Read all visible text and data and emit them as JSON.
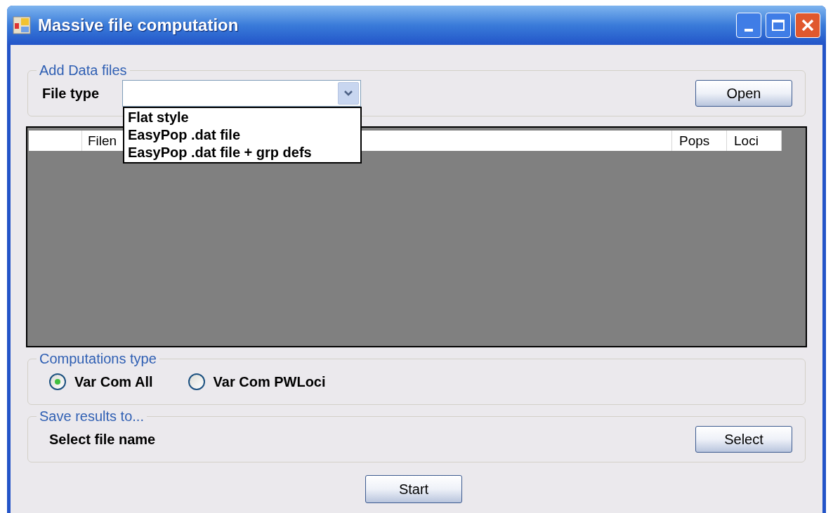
{
  "window": {
    "title": "Massive file computation"
  },
  "add_data_files": {
    "legend": "Add Data files",
    "file_type_label": "File type",
    "expanded": true,
    "options": [
      {
        "label": "Flat style"
      },
      {
        "label": "EasyPop .dat file"
      },
      {
        "label": "EasyPop .dat file + grp defs"
      }
    ],
    "open_button": "Open"
  },
  "table": {
    "columns": [
      "Filen",
      "Pops",
      "Loci"
    ]
  },
  "computations_type": {
    "legend": "Computations type",
    "options": [
      {
        "label": "Var Com All",
        "selected": true
      },
      {
        "label": "Var Com PWLoci",
        "selected": false
      }
    ]
  },
  "save_results": {
    "legend": "Save results to...",
    "label": "Select file name",
    "select_button": "Select"
  },
  "start_button": "Start"
}
